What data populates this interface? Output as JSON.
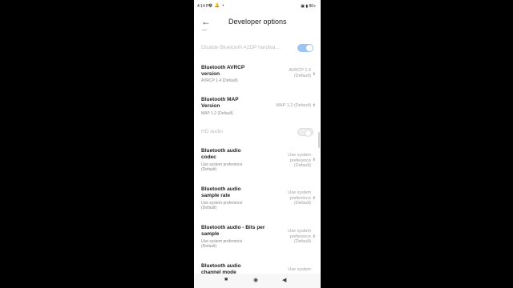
{
  "status": {
    "time": "4:14 PM",
    "left_icons": "⚙ 🔔 ▪",
    "right_icons": "▣ ▮ 86+"
  },
  "appbar": {
    "back": "←",
    "title": "Developer options"
  },
  "settings": [
    {
      "label": "Disable Bluetooth A2DP hardwa...",
      "type": "toggle",
      "state": "on",
      "disabled": true
    },
    {
      "label": "Bluetooth AVRCP version",
      "sub": "AVRCP 1.4 (Default)",
      "value": "AVRCP 1.4 (Default)"
    },
    {
      "label": "Bluetooth MAP Version",
      "sub": "MAP 1.2 (Default)",
      "value": "MAP 1.2 (Default)"
    },
    {
      "label": "HD audio",
      "type": "toggle",
      "state": "off",
      "disabled": true
    },
    {
      "label": "Bluetooth audio codec",
      "sub": "Use system preference (Default)",
      "value": "Use system preference (Default)"
    },
    {
      "label": "Bluetooth audio sample rate",
      "sub": "Use system preference (Default)",
      "value": "Use system preference (Default)"
    },
    {
      "label": "Bluetooth audio - Bits per sample",
      "sub": "Use system preference (Default)",
      "value": "Use system preference (Default)"
    },
    {
      "label": "Bluetooth audio channel mode",
      "value": "Use system"
    }
  ],
  "nav": {
    "recents": "■",
    "home": "◉",
    "back": "◀"
  },
  "colors": {
    "toggle_on": "#9bc3f3",
    "value_text": "#9e9e9e"
  }
}
